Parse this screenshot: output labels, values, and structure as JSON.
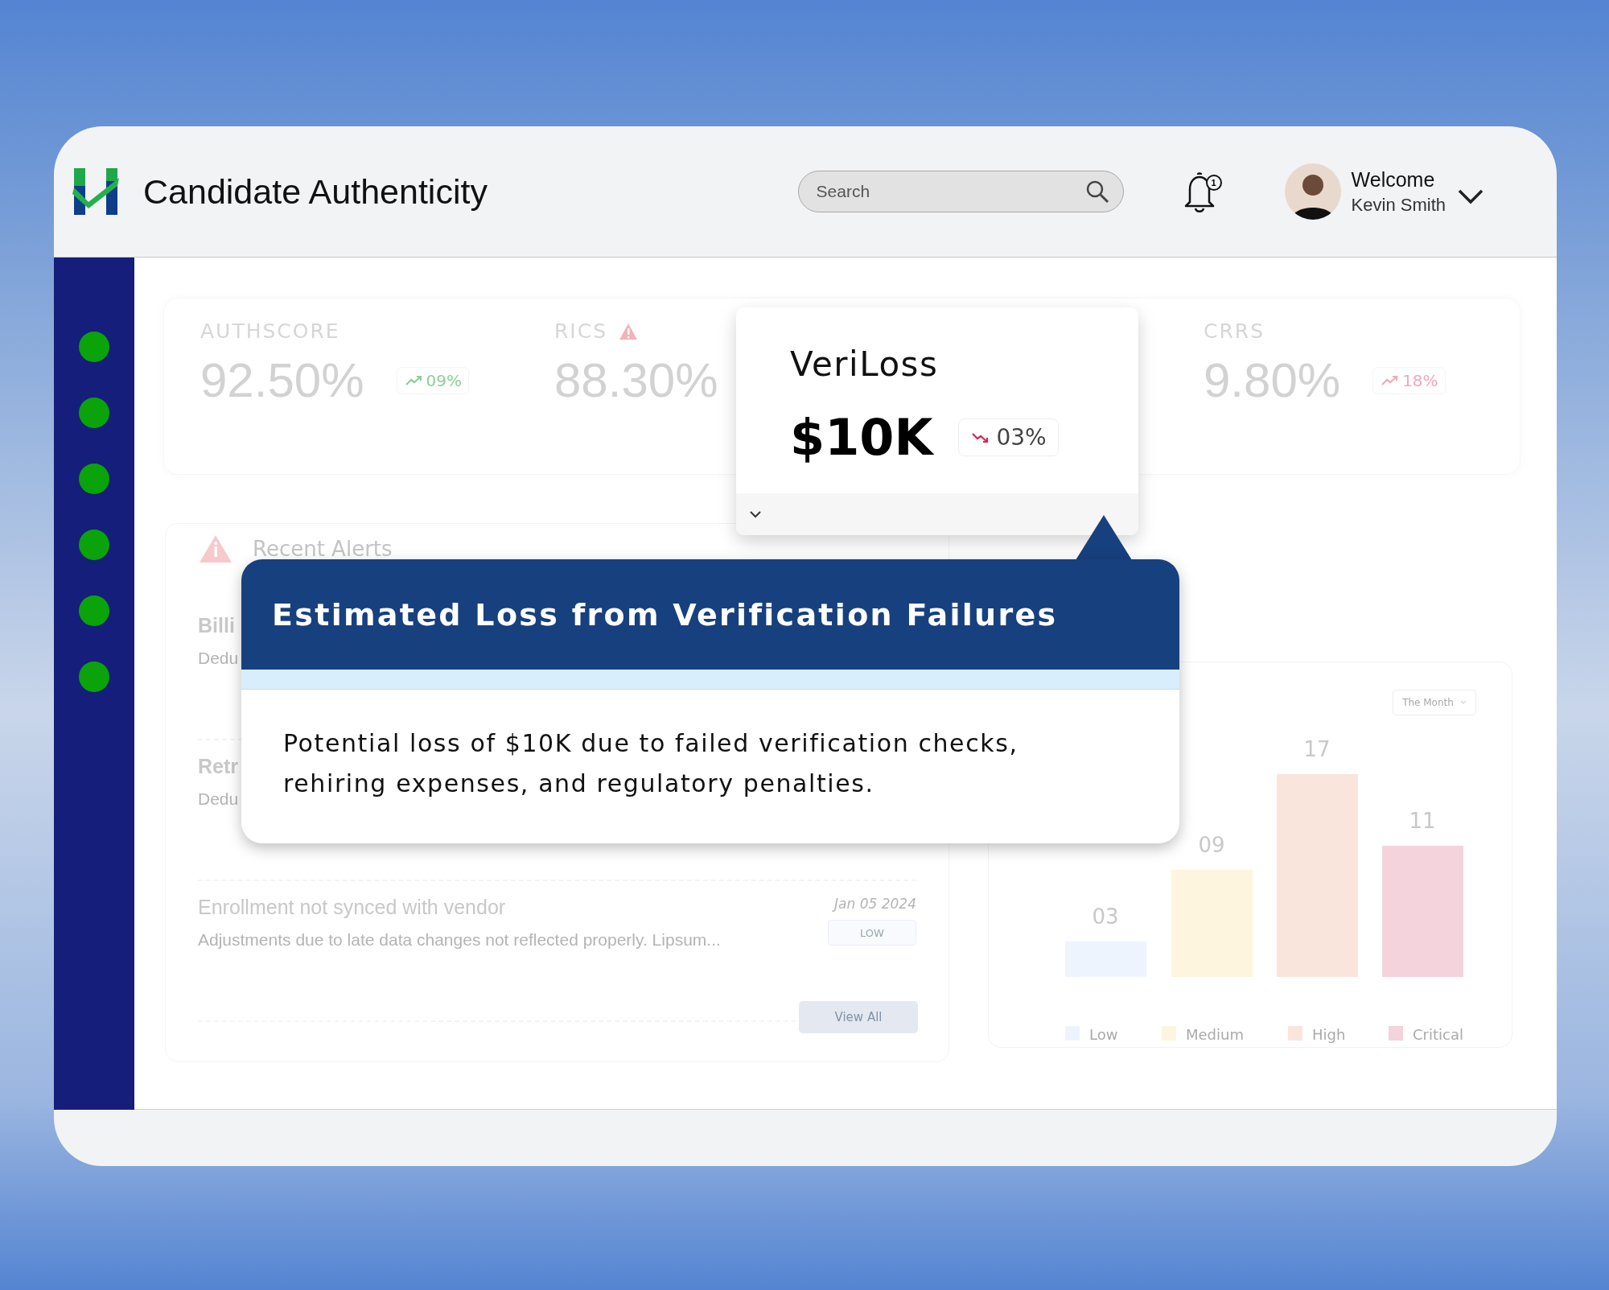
{
  "header": {
    "title": "Candidate Authenticity",
    "search": {
      "placeholder": "Search"
    },
    "notifications": {
      "count": "1"
    },
    "user": {
      "greeting": "Welcome",
      "name": "Kevin Smith"
    }
  },
  "sidebar": {
    "items": [
      {
        "kind": "dot"
      },
      {
        "kind": "dot"
      },
      {
        "kind": "dot"
      },
      {
        "kind": "dot"
      },
      {
        "kind": "dot"
      },
      {
        "kind": "dot"
      }
    ]
  },
  "stats": [
    {
      "label": "AUTHSCORE",
      "value": "92.50%",
      "warning": false,
      "change": "09%",
      "decreasing": false,
      "color": "#8fcf98"
    },
    {
      "label": "RICS",
      "value": "88.30%",
      "warning": true
    },
    {
      "label": "CRRS",
      "value": "9.80%",
      "warning": false,
      "change": "18%",
      "decreasing": false,
      "color": "#f2a9b8"
    }
  ],
  "veriloss": {
    "title": "VeriLoss",
    "value": "$10K",
    "change": "03%",
    "decreasing": true,
    "color": "#e0204f"
  },
  "alerts": {
    "title": "Recent Alerts",
    "items": [
      {
        "title": "Billi",
        "description": "Dedu"
      },
      {
        "title": "Retr",
        "description": "Dedu"
      },
      {
        "title": "Enrollment not synced with vendor",
        "description": "Adjustments due to late data changes not reflected properly. Lipsum...",
        "date": "Jan 05 2024",
        "priority": "LOW"
      }
    ],
    "button": "View All"
  },
  "chart": {
    "dropdown": "The Month",
    "chart_data": {
      "type": "bar",
      "categories": [
        "Low",
        "Medium",
        "High",
        "Critical"
      ],
      "values": [
        3,
        9,
        17,
        11
      ],
      "value_labels": [
        "03",
        "09",
        "17",
        "11"
      ]
    },
    "legend": [
      {
        "color": "#eef4fe"
      },
      {
        "color": "#fdf5de"
      },
      {
        "color": "#fae5dc"
      },
      {
        "color": "#f5d3dc"
      }
    ]
  },
  "tooltip": {
    "title": "Estimated Loss from Verification Failures",
    "body": "Potential loss of $10K due to failed verification checks, rehiring expenses, and regulatory penalties."
  }
}
